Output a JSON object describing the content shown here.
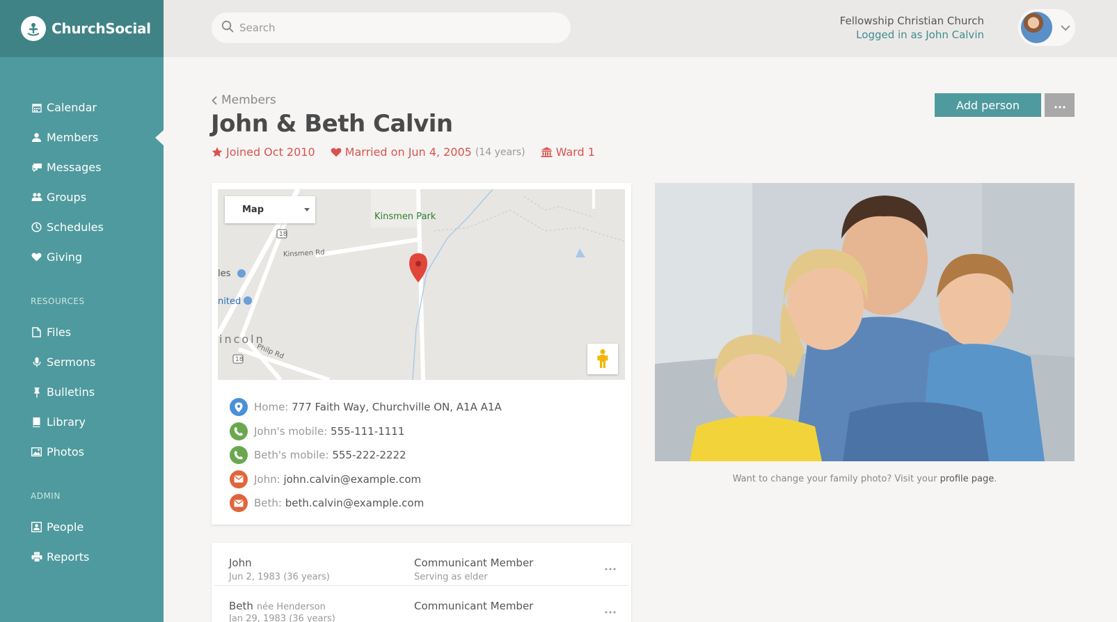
{
  "brand": {
    "name": "ChurchSocial"
  },
  "search": {
    "placeholder": "Search"
  },
  "account": {
    "church": "Fellowship Christian Church",
    "logged_in": "Logged in as John Calvin"
  },
  "nav": {
    "main": [
      {
        "label": "Calendar",
        "icon": "calendar-icon"
      },
      {
        "label": "Members",
        "icon": "person-icon",
        "active": true
      },
      {
        "label": "Messages",
        "icon": "chat-icon"
      },
      {
        "label": "Groups",
        "icon": "group-icon"
      },
      {
        "label": "Schedules",
        "icon": "clock-icon"
      },
      {
        "label": "Giving",
        "icon": "heart-icon"
      }
    ],
    "resources_heading": "RESOURCES",
    "resources": [
      {
        "label": "Files",
        "icon": "file-icon"
      },
      {
        "label": "Sermons",
        "icon": "microphone-icon"
      },
      {
        "label": "Bulletins",
        "icon": "pushpin-icon"
      },
      {
        "label": "Library",
        "icon": "book-icon"
      },
      {
        "label": "Photos",
        "icon": "image-icon"
      }
    ],
    "admin_heading": "ADMIN",
    "admin": [
      {
        "label": "People",
        "icon": "contact-card-icon"
      },
      {
        "label": "Reports",
        "icon": "printer-icon"
      }
    ]
  },
  "page": {
    "back_label": "Members",
    "title": "John & Beth Calvin",
    "joined": "Joined Oct 2010",
    "married": "Married on Jun 4, 2005",
    "married_years": "(14 years)",
    "ward": "Ward 1",
    "add_person": "Add person"
  },
  "map": {
    "type": "Map",
    "park": "Kinsmen Park",
    "road": "Kinsmen Rd",
    "road2": "Philp Rd",
    "route": "18",
    "frag_les": "les",
    "frag_nited": "nited",
    "frag_lincoln": "incoln"
  },
  "contacts": [
    {
      "label": "Home:",
      "value": "777 Faith Way, Churchville ON, A1A A1A",
      "icon": "location-icon",
      "color": "#4a90d9"
    },
    {
      "label": "John's mobile:",
      "value": "555-111-1111",
      "icon": "phone-icon",
      "color": "#6aa84f"
    },
    {
      "label": "Beth's mobile:",
      "value": "555-222-2222",
      "icon": "phone-icon",
      "color": "#6aa84f"
    },
    {
      "label": "John:",
      "value": "john.calvin@example.com",
      "icon": "envelope-icon",
      "color": "#e0653a"
    },
    {
      "label": "Beth:",
      "value": "beth.calvin@example.com",
      "icon": "envelope-icon",
      "color": "#e0653a"
    }
  ],
  "members": [
    {
      "name": "John",
      "nee": "",
      "dob": "Jun 2, 1983 (36 years)",
      "role": "Communicant Member",
      "note": "Serving as elder"
    },
    {
      "name": "Beth",
      "nee": "née Henderson",
      "dob": "Jan 29, 1983 (36 years)",
      "role": "Communicant Member",
      "note": ""
    }
  ],
  "photo_caption": {
    "text": "Want to change your family photo? Visit your ",
    "link": "profile page",
    "end": "."
  },
  "colors": {
    "sidebar": "#4f9a9e",
    "brand_bar": "#3f8387",
    "accent_red": "#d9534f",
    "button_teal": "#4f9a9e"
  }
}
